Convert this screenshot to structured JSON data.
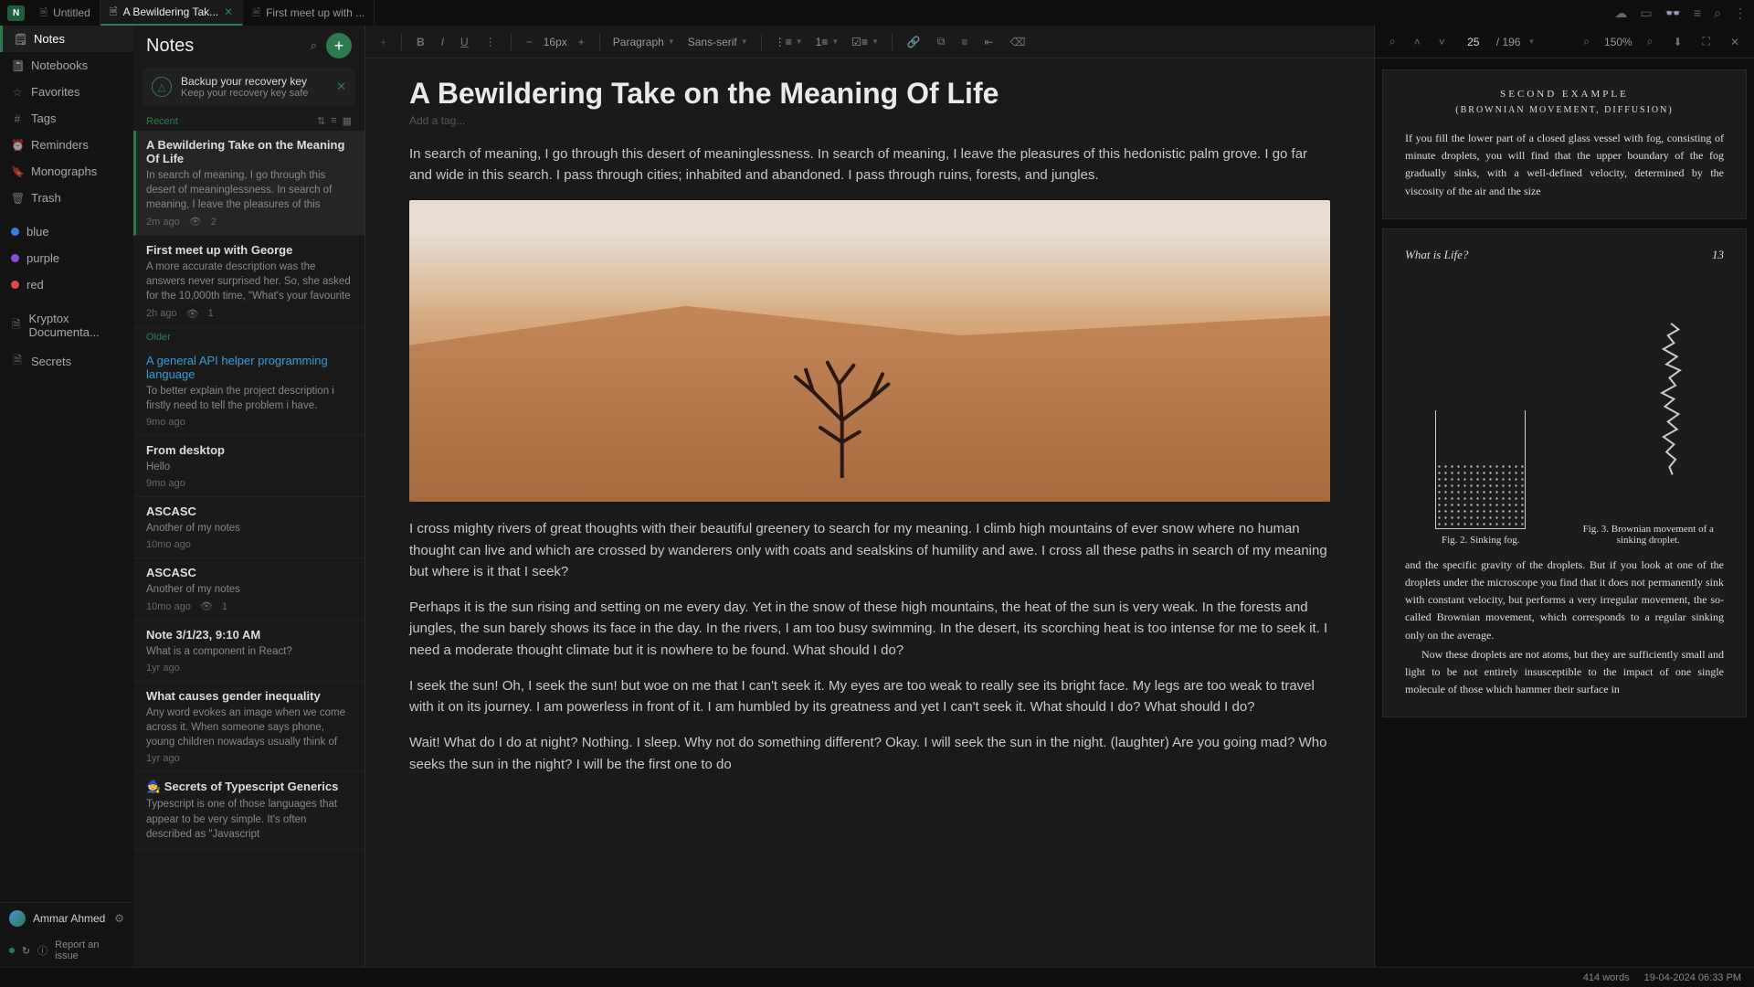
{
  "titlebar": {
    "logo": "N",
    "tabs": [
      {
        "label": "Untitled"
      },
      {
        "label": "A Bewildering Tak..."
      },
      {
        "label": "First meet up with ..."
      }
    ],
    "icons": [
      "cloud-upload",
      "book",
      "glasses",
      "list",
      "search",
      "more"
    ]
  },
  "sidebar": {
    "primary": [
      {
        "icon": "notes",
        "label": "Notes",
        "active": true
      },
      {
        "icon": "notebooks",
        "label": "Notebooks"
      },
      {
        "icon": "star",
        "label": "Favorites"
      },
      {
        "icon": "hash",
        "label": "Tags"
      },
      {
        "icon": "clock",
        "label": "Reminders"
      },
      {
        "icon": "bookmark",
        "label": "Monographs"
      },
      {
        "icon": "trash",
        "label": "Trash"
      }
    ],
    "colors": [
      {
        "name": "blue",
        "label": "blue"
      },
      {
        "name": "purple",
        "label": "purple"
      },
      {
        "name": "red",
        "label": "red"
      }
    ],
    "extras": [
      {
        "icon": "doc",
        "label": "Kryptox Documenta..."
      },
      {
        "icon": "doc",
        "label": "Secrets"
      }
    ],
    "user": "Ammar Ahmed",
    "status": "Report an issue"
  },
  "notelist": {
    "title": "Notes",
    "backup": {
      "line1": "Backup your recovery key",
      "line2": "Keep your recovery key safe"
    },
    "section_recent": "Recent",
    "section_older": "Older",
    "recent": [
      {
        "title": "A Bewildering Take on the Meaning Of Life",
        "preview": "In search of meaning, I go through this desert of meaninglessness. In search of meaning, I leave the pleasures of this hedonistic palm grove. I go far and wide in this search. I pass through cities; inhabited ...",
        "time": "2m ago",
        "count": "2",
        "active": true
      },
      {
        "title": "First meet up with George",
        "preview": "A more accurate description was the answers never surprised her. So, she asked for the 10,000th time, \"What's your favourite animal?\" But this time was different. When she heard the young boy's answer,...",
        "time": "2h ago",
        "count": "1"
      }
    ],
    "older": [
      {
        "title": "A general API helper programming language",
        "link": true,
        "preview": "To better explain the project description i firstly need to tell the problem i have.",
        "time": "9mo ago"
      },
      {
        "title": "From desktop",
        "preview": "Hello",
        "time": "9mo ago"
      },
      {
        "title": "ASCASC",
        "preview": "Another of my notes",
        "time": "10mo ago"
      },
      {
        "title": "ASCASC",
        "preview": "Another of my notes",
        "time": "10mo ago",
        "count": "1"
      },
      {
        "title": "Note 3/1/23, 9:10 AM",
        "preview": "What is a component in React?",
        "time": "1yr ago"
      },
      {
        "title": "What causes gender inequality",
        "preview": "Any word evokes an image when we come across it. When someone says phone, young children nowadays usually think of smartphones instead of pay-phones and old clunkers. Similarly, when ...",
        "time": "1yr ago"
      },
      {
        "title": "🧙 Secrets of Typescript Generics",
        "preview": "Typescript is one of those languages that appear to be very simple. It's often described as \"Javascript",
        "time": ""
      }
    ]
  },
  "editor": {
    "toolbar": {
      "font_size": "16px",
      "block": "Paragraph",
      "font": "Sans-serif"
    },
    "title": "A Bewildering Take on the Meaning Of Life",
    "tag_placeholder": "Add a tag...",
    "p1": "In search of meaning, I go through this desert of meaninglessness. In search of meaning, I leave the pleasures of this hedonistic palm grove. I go far and wide in this search. I pass through cities; inhabited and abandoned. I pass through ruins, forests, and jungles.",
    "p2": "I cross mighty rivers of great thoughts with their beautiful greenery to search for my meaning. I climb high mountains of ever snow where no human thought can live and which are crossed by wanderers only with coats and sealskins of humility and awe. I cross all these paths in search of my meaning but where is it that I seek?",
    "p3": "Perhaps it is the sun rising and setting on me every day. Yet in the snow of these high mountains, the heat of the sun is very weak. In the forests and jungles, the sun barely shows its face in the day. In the rivers, I am too busy swimming. In the desert, its scorching heat is too intense for me to seek it. I need a moderate thought climate but it is nowhere to be found. What should I do?",
    "p4": "I seek the sun! Oh, I seek the sun! but woe on me that I can't seek it. My eyes are too weak to really see its bright face. My legs are too weak to travel with it on its journey. I am powerless in front of it. I am humbled by its greatness and yet I can't seek it. What should I do? What should I do?",
    "p5": "Wait! What do I do at night? Nothing. I sleep. Why not do something different? Okay. I will seek the sun in the night. (laughter) Are you going mad? Who seeks the sun in the night? I will be the first one to do"
  },
  "pdf": {
    "page": "25",
    "total": "/ 196",
    "zoom": "150%",
    "page1": {
      "heading": "SECOND EXAMPLE",
      "sub": "(BROWNIAN MOVEMENT, DIFFUSION)",
      "body": "If you fill the lower part of a closed glass vessel with fog, consisting of minute droplets, you will find that the upper boundary of the fog gradually sinks, with a well-defined velocity, determined by the viscosity of the air and the size"
    },
    "page2": {
      "running_head": "What is Life?",
      "page_num": "13",
      "fig1_caption": "Fig. 2. Sinking fog.",
      "fig2_caption": "Fig. 3. Brownian movement of a sinking droplet.",
      "body1": "and the specific gravity of the droplets. But if you look at one of the droplets under the microscope you find that it does not permanently sink with constant velocity, but performs a very irregular movement, the so-called Brownian movement, which corresponds to a regular sinking only on the average.",
      "body2": "Now these droplets are not atoms, but they are sufficiently small and light to be not entirely insusceptible to the impact of one single molecule of those which hammer their surface in"
    }
  },
  "statusbar": {
    "words": "414 words",
    "datetime": "19-04-2024 06:33 PM"
  }
}
